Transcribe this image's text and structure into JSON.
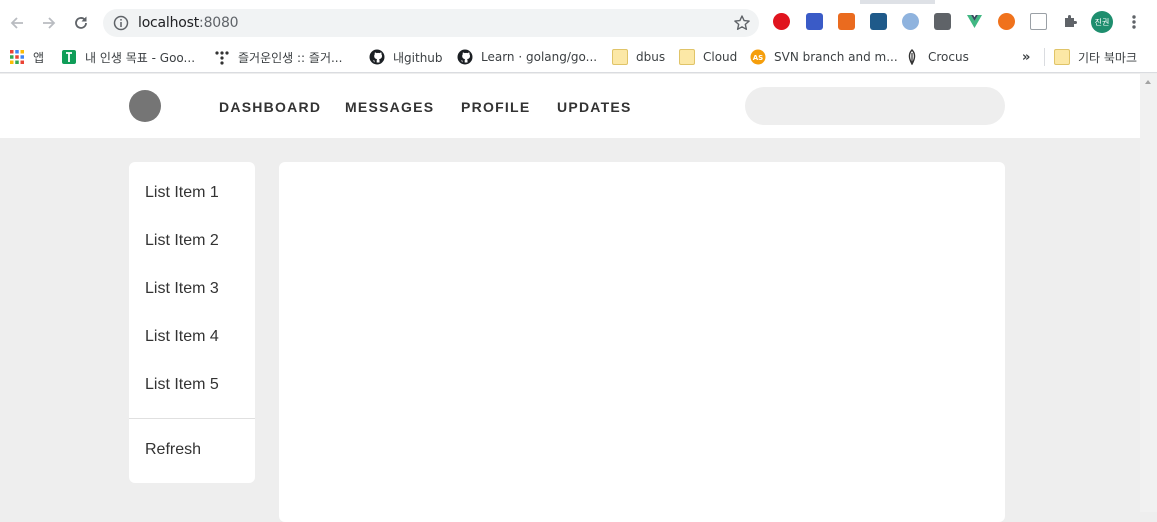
{
  "browser": {
    "url_host": "localhost",
    "url_port": ":8080",
    "profile_label": "진권"
  },
  "bookmarks": {
    "apps": "앱",
    "items": [
      "내 인생 목표 - Goo...",
      "즐거운인생 :: 즐거...",
      "내github",
      "Learn · golang/go...",
      "dbus",
      "Cloud",
      "SVN branch and m...",
      "Crocus"
    ],
    "overflow": "»",
    "other": "기타 북마크"
  },
  "header": {
    "nav": [
      "Dashboard",
      "Messages",
      "Profile",
      "Updates"
    ],
    "search_value": ""
  },
  "sidebar": {
    "items": [
      "List Item 1",
      "List Item 2",
      "List Item 3",
      "List Item 4",
      "List Item 5"
    ],
    "refresh": "Refresh"
  }
}
